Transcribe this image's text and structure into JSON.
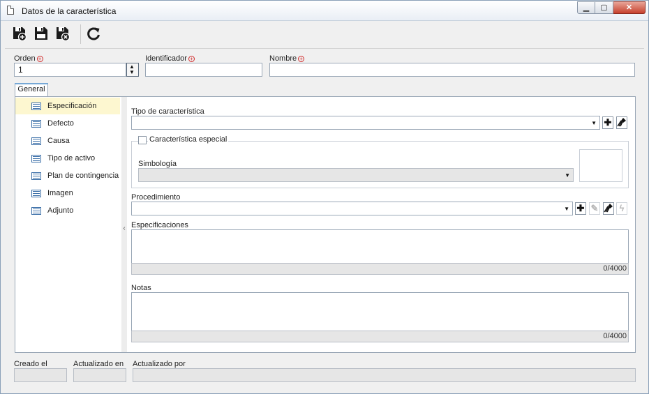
{
  "window": {
    "title": "Datos de la característica",
    "min_glyph": "▁",
    "max_glyph": "▢",
    "close_glyph": "✕"
  },
  "toolbar": {
    "buttons": [
      {
        "icon": "save-new-icon"
      },
      {
        "icon": "save-icon"
      },
      {
        "icon": "save-close-icon"
      },
      {
        "icon": "refresh-icon"
      }
    ]
  },
  "form": {
    "orden": {
      "label": "Orden",
      "value": "1"
    },
    "identificador": {
      "label": "Identificador",
      "value": ""
    },
    "nombre": {
      "label": "Nombre",
      "value": ""
    },
    "required_glyph": "+"
  },
  "tabs": [
    {
      "label": "General"
    }
  ],
  "sidebar": {
    "items": [
      {
        "label": "Especificación"
      },
      {
        "label": "Defecto"
      },
      {
        "label": "Causa"
      },
      {
        "label": "Tipo de activo"
      },
      {
        "label": "Plan de contingencia"
      },
      {
        "label": "Imagen"
      },
      {
        "label": "Adjunto"
      }
    ],
    "selected": "Especificación",
    "collapse_glyph": "‹"
  },
  "spec": {
    "tipo_label": "Tipo de característica",
    "especial_label": "Característica especial",
    "simbologia_label": "Simbología",
    "procedimiento_label": "Procedimiento",
    "especificaciones_label": "Especificaciones",
    "especificaciones_counter": "0/4000",
    "notas_label": "Notas",
    "notas_counter": "0/4000",
    "add_glyph": "✚",
    "clear_glyph": "✎",
    "edit_glyph": "✎",
    "run_glyph": "ϟ",
    "dropdown_glyph": "▼"
  },
  "footer": {
    "creado_label": "Creado el",
    "actualizado_en_label": "Actualizado en",
    "actualizado_por_label": "Actualizado por"
  },
  "colors": {
    "accent": "#76a8d6",
    "selected_bg": "#fdf7d0",
    "required": "#d02a2a"
  }
}
